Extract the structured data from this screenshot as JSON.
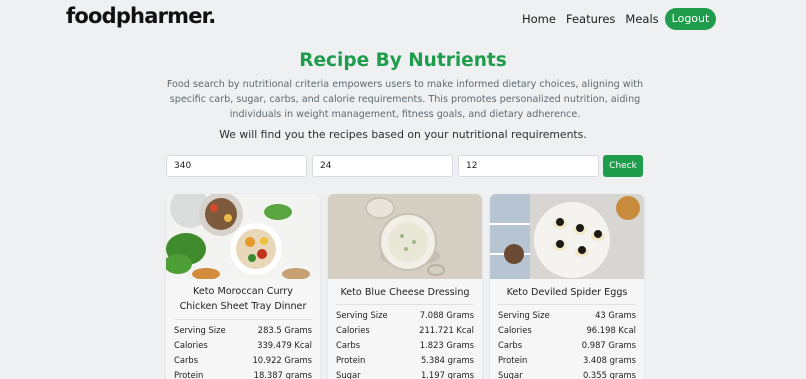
{
  "brand": {
    "name": "foodpharmer."
  },
  "nav": {
    "links": [
      "Home",
      "Features",
      "Meals"
    ],
    "logout_label": "Logout"
  },
  "hero": {
    "title": "Recipe By Nutrients",
    "description": "Food search by nutritional criteria empowers users to make informed dietary choices, aligning with specific carb, sugar, carbs, and calorie requirements. This promotes personalized nutrition, aiding individuals in weight management, fitness goals, and dietary adherence.",
    "subtitle": "We will find you the recipes based on your nutritional requirements."
  },
  "search": {
    "fields": [
      "340",
      "24",
      "12"
    ],
    "check_label": "Check"
  },
  "colors": {
    "accent": "#1f9d4c",
    "background": "#eef0f2"
  },
  "recipes": [
    {
      "title": "Keto Moroccan Curry Chicken Sheet Tray Dinner",
      "nutrients": [
        {
          "name": "Serving Size",
          "value": "283.5 Grams"
        },
        {
          "name": "Calories",
          "value": "339.479 Kcal"
        },
        {
          "name": "Carbs",
          "value": "10.922 Grams"
        },
        {
          "name": "Protein",
          "value": "18.387 grams"
        }
      ]
    },
    {
      "title": "Keto Blue Cheese Dressing",
      "nutrients": [
        {
          "name": "Serving Size",
          "value": "7.088 Grams"
        },
        {
          "name": "Calories",
          "value": "211.721 Kcal"
        },
        {
          "name": "Carbs",
          "value": "1.823 Grams"
        },
        {
          "name": "Protein",
          "value": "5.384 grams"
        },
        {
          "name": "Sugar",
          "value": "1.197 grams"
        }
      ]
    },
    {
      "title": "Keto Deviled Spider Eggs",
      "nutrients": [
        {
          "name": "Serving Size",
          "value": "43 Grams"
        },
        {
          "name": "Calories",
          "value": "96.198 Kcal"
        },
        {
          "name": "Carbs",
          "value": "0.987 Grams"
        },
        {
          "name": "Protein",
          "value": "3.408 grams"
        },
        {
          "name": "Sugar",
          "value": "0.355 grams"
        }
      ]
    }
  ]
}
